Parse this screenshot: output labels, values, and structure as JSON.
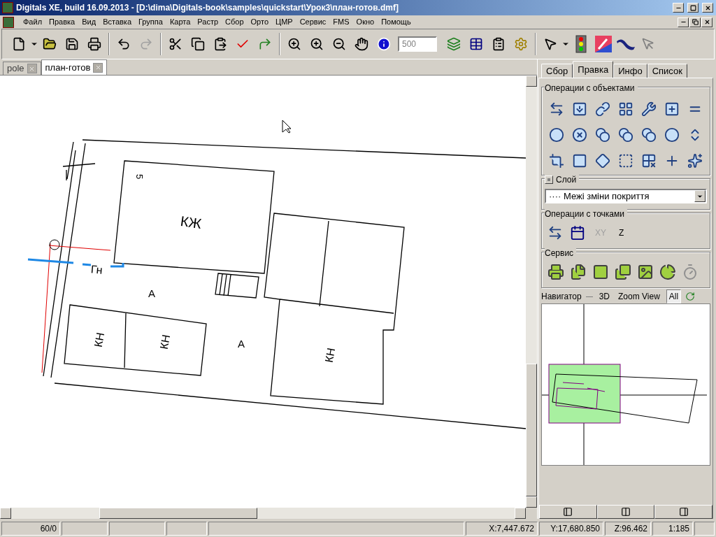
{
  "window": {
    "title": "Digitals XE, build 16.09.2013 - [D:\\dima\\Digitals-book\\samples\\quickstart\\Урок3\\план-готов.dmf]"
  },
  "menu": [
    "Файл",
    "Правка",
    "Вид",
    "Вставка",
    "Группа",
    "Карта",
    "Растр",
    "Сбор",
    "Орто",
    "ЦМР",
    "Сервис",
    "FMS",
    "Окно",
    "Помощь"
  ],
  "toolbar": {
    "scale_field": {
      "value": "500"
    },
    "redo_disabled": true
  },
  "doc_tabs": [
    {
      "label": "pole",
      "selected": false
    },
    {
      "label": "план-готов",
      "selected": true
    }
  ],
  "map_labels": [
    {
      "text": "5"
    },
    {
      "text": "КЖ"
    },
    {
      "text": "Гн"
    },
    {
      "text": "А"
    },
    {
      "text": "КН"
    },
    {
      "text": "КН"
    },
    {
      "text": "А"
    },
    {
      "text": "КН"
    }
  ],
  "panel": {
    "tabs": [
      {
        "label": "Сбор",
        "selected": false
      },
      {
        "label": "Правка",
        "selected": true
      },
      {
        "label": "Инфо",
        "selected": false
      },
      {
        "label": "Список",
        "selected": false
      }
    ],
    "object_ops": {
      "title": "Операции с объектами"
    },
    "layer": {
      "title": "Слой",
      "value": "···· Межі зміни покриття"
    },
    "point_ops": {
      "title": "Операции с точками",
      "text_tools": [
        {
          "label": "XY",
          "disabled": true
        },
        {
          "label": "Z",
          "disabled": false
        }
      ]
    },
    "service": {
      "title": "Сервис"
    },
    "navigator": {
      "title": "Навигатор",
      "buttons": [
        {
          "label": "3D",
          "selected": false
        },
        {
          "label": "Zoom View",
          "selected": false
        },
        {
          "label": "All",
          "selected": true
        }
      ]
    }
  },
  "status_bar": {
    "cells": [
      {
        "text": "60/0"
      },
      {
        "text": ""
      },
      {
        "text": ""
      },
      {
        "text": ""
      },
      {
        "text": ""
      },
      {
        "text": "X:7,447.672"
      },
      {
        "text": "Y:17,680.850"
      },
      {
        "text": "Z:96.462"
      },
      {
        "text": "1:185"
      }
    ]
  }
}
